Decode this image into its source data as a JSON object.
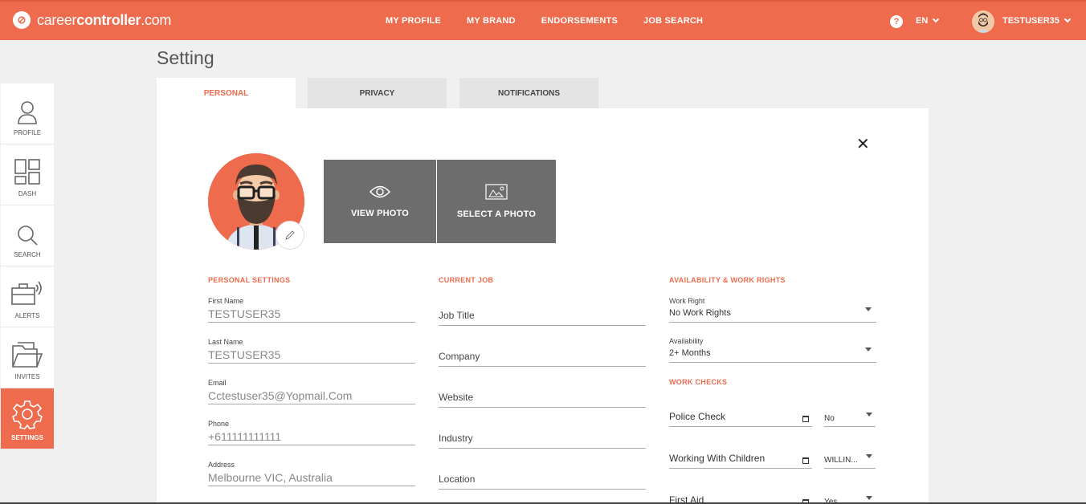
{
  "brand": {
    "logo_glyph": "⊘",
    "name_prefix": "career",
    "name_bold": "controller",
    "name_suffix": ".com"
  },
  "topnav": [
    "MY PROFILE",
    "MY BRAND",
    "ENDORSEMENTS",
    "JOB SEARCH"
  ],
  "help_glyph": "?",
  "language": "EN",
  "user": {
    "name": "TESTUSER35"
  },
  "sidebar": [
    {
      "label": "PROFILE",
      "icon": "person-icon"
    },
    {
      "label": "DASH",
      "icon": "dashboard-icon"
    },
    {
      "label": "SEARCH",
      "icon": "search-icon"
    },
    {
      "label": "ALERTS",
      "icon": "briefcase-alert-icon"
    },
    {
      "label": "INVITES",
      "icon": "folder-icon"
    },
    {
      "label": "SETTINGS",
      "icon": "gear-icon",
      "active": true
    }
  ],
  "page": {
    "title": "Setting"
  },
  "tabs": [
    {
      "label": "PERSONAL",
      "active": true
    },
    {
      "label": "PRIVACY"
    },
    {
      "label": "NOTIFICATIONS"
    }
  ],
  "close_glyph": "✕",
  "photo": {
    "view_label": "VIEW PHOTO",
    "select_label": "SELECT A PHOTO"
  },
  "personal": {
    "heading": "PERSONAL SETTINGS",
    "fields": [
      {
        "label": "First Name",
        "value": "TESTUSER35"
      },
      {
        "label": "Last Name",
        "value": "TESTUSER35"
      },
      {
        "label": "Email",
        "value": "Cctestuser35@Yopmail.Com"
      },
      {
        "label": "Phone",
        "value": "+611111111111"
      },
      {
        "label": "Address",
        "value": "Melbourne VIC, Australia"
      }
    ]
  },
  "current_job": {
    "heading": "CURRENT JOB",
    "fields": [
      "Job Title",
      "Company",
      "Website",
      "Industry",
      "Location"
    ]
  },
  "availability": {
    "heading": "AVAILABILITY & WORK RIGHTS",
    "work_right": {
      "label": "Work Right",
      "value": "No Work Rights"
    },
    "availability": {
      "label": "Availability",
      "value": "2+ Months"
    }
  },
  "work_checks": {
    "heading": "WORK CHECKS",
    "items": [
      {
        "label": "Police Check",
        "value": "No"
      },
      {
        "label": "Working With Children",
        "value": "WILLIN..."
      },
      {
        "label": "First Aid",
        "value": "Yes"
      }
    ]
  },
  "colors": {
    "accent": "#ee6b4d",
    "photo_button": "#6d6d6d"
  }
}
